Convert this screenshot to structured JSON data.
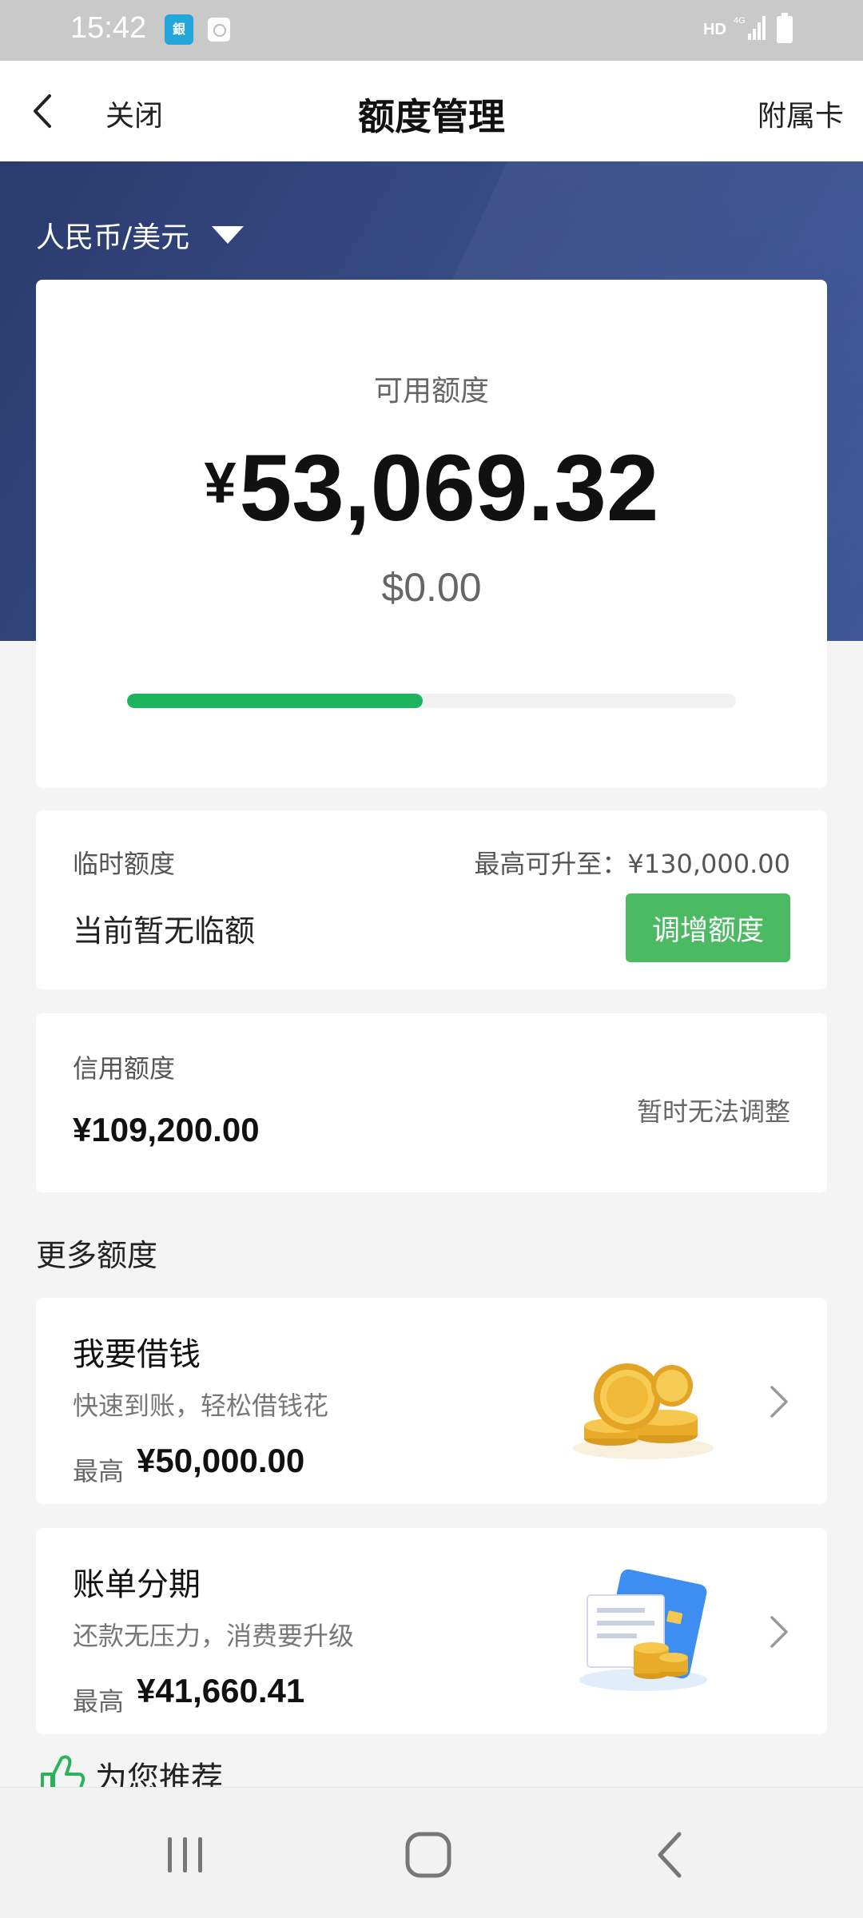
{
  "status_bar": {
    "time": "15:42",
    "network": "HD",
    "signal": "4G"
  },
  "nav": {
    "close_label": "关闭",
    "title": "额度管理",
    "right_label": "附属卡"
  },
  "currency": {
    "selected": "人民币/美元"
  },
  "available": {
    "label": "可用额度",
    "currency_symbol": "¥",
    "amount": "53,069.32",
    "usd_amount": "$0.00",
    "progress_fraction": 0.485
  },
  "temporary": {
    "label": "临时额度",
    "max_text": "最高可升至：¥130,000.00",
    "status": "当前暂无临额",
    "button_label": "调增额度"
  },
  "credit": {
    "label": "信用额度",
    "amount": "¥109,200.00",
    "note": "暂时无法调整"
  },
  "more": {
    "section_title": "更多额度"
  },
  "offers": [
    {
      "title": "我要借钱",
      "desc": "快速到账，轻松借钱花",
      "max_label": "最高",
      "max_value": "¥50,000.00",
      "icon": "gold-coins-icon"
    },
    {
      "title": "账单分期",
      "desc": "还款无压力，消费要升级",
      "max_label": "最高",
      "max_value": "¥41,660.41",
      "icon": "bill-card-icon"
    }
  ],
  "recommend": {
    "title": "为您推荐",
    "icon": "thumbs-up-icon"
  },
  "colors": {
    "hero_blue": "#364a84",
    "progress_green": "#1db45f",
    "button_green": "#4cba62"
  }
}
